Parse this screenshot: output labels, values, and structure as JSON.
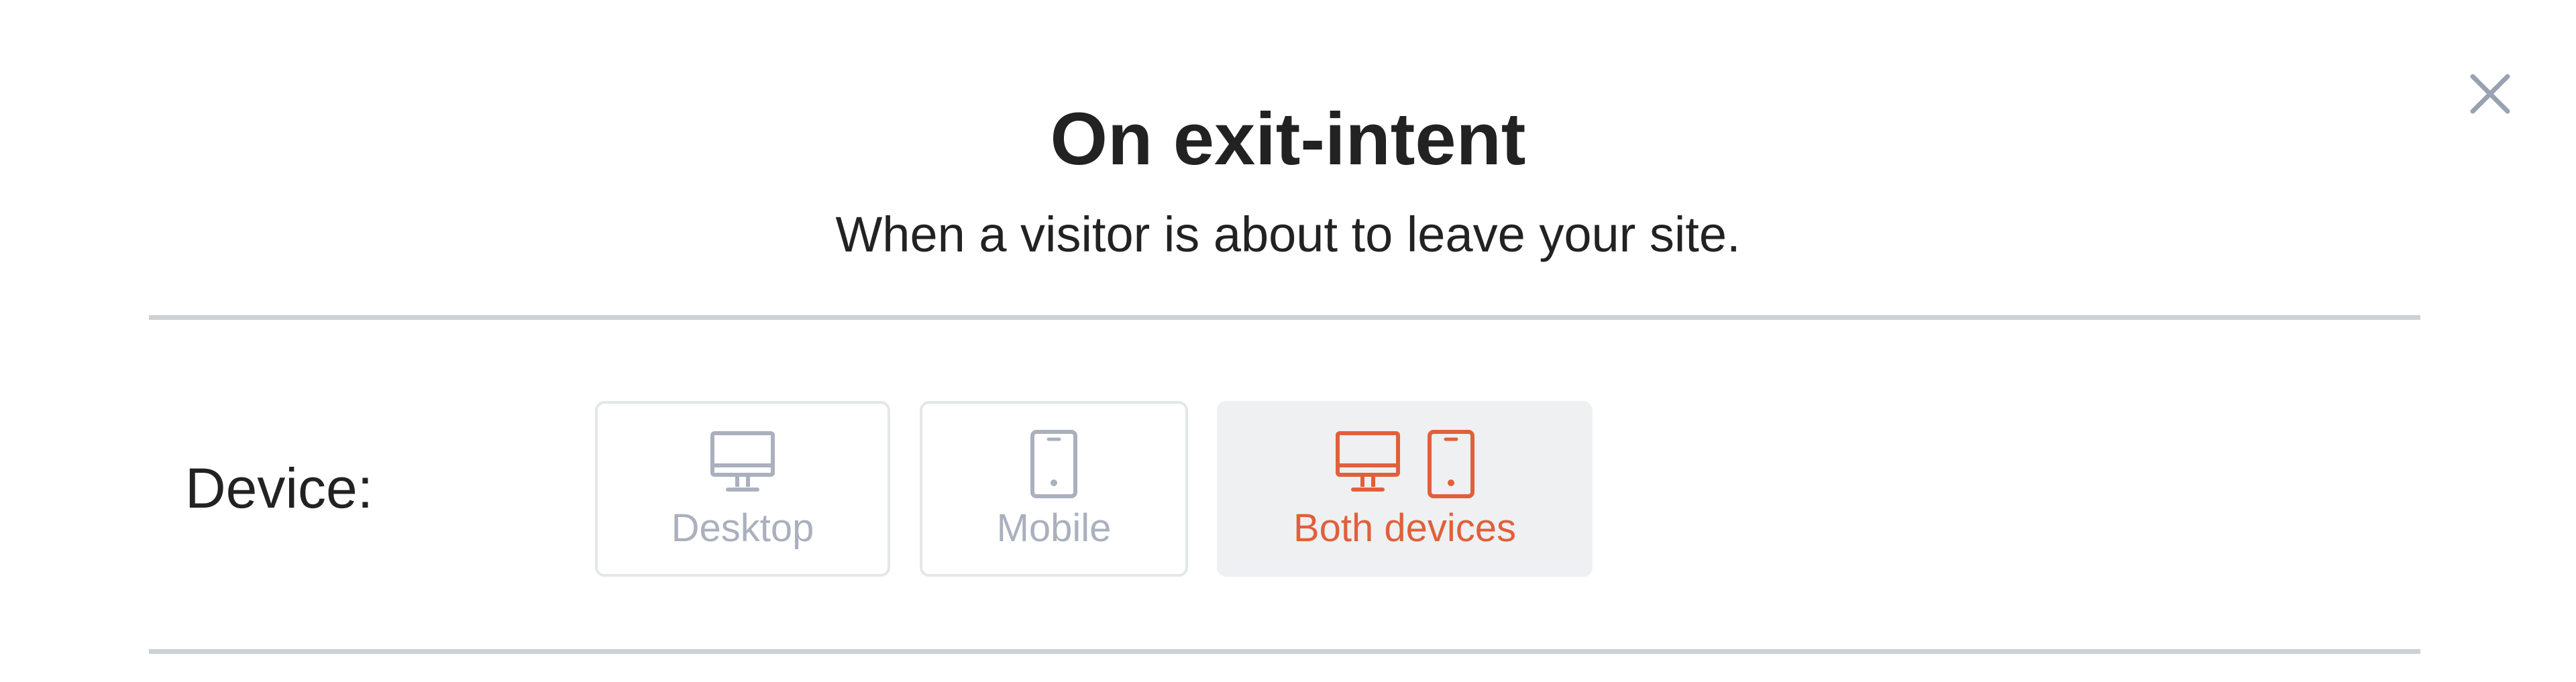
{
  "modal": {
    "title": "On exit-intent",
    "subtitle": "When a visitor is about to leave your site."
  },
  "device": {
    "label": "Device:",
    "options": [
      {
        "label": "Desktop",
        "icons": [
          "desktop-icon"
        ],
        "selected": false
      },
      {
        "label": "Mobile",
        "icons": [
          "mobile-icon"
        ],
        "selected": false
      },
      {
        "label": "Both devices",
        "icons": [
          "desktop-icon",
          "mobile-icon"
        ],
        "selected": true
      }
    ]
  },
  "icons": {
    "close": "close-icon"
  },
  "colors": {
    "accent": "#e0603a",
    "muted": "#aab0bd",
    "text": "#222222",
    "divider": "#cdd0d4",
    "selected_bg": "#eef0f2"
  }
}
